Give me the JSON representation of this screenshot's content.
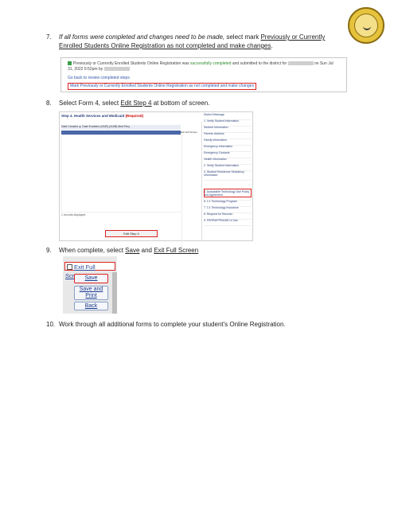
{
  "seal_text": "SCHOOL BOARD OF FLORIDA",
  "steps": {
    "s7": {
      "num": "7.",
      "intro": "If all forms were completed and changes need to be made,",
      "mid": " select mark ",
      "link": "Previously or Currently Enrolled Students Online Registration as not completed and make changes",
      "end": "."
    },
    "s8": {
      "num": "8.",
      "pre": "Select Form 4, select ",
      "link": "Edit Step 4",
      "post": " at bottom of screen."
    },
    "s9": {
      "num": "9.",
      "pre": "When complete, select ",
      "link1": "Save",
      "mid": " and ",
      "link2": "Exit Full Screen"
    },
    "s10": {
      "num": "10.",
      "text": "Work through all additional forms to complete your student's Online Registration."
    }
  },
  "panel7": {
    "line1a": "Previously or Currently Enrolled Students Online Registration was ",
    "line1b": "successfully completed",
    "line1c": " and submitted to the district for ",
    "line1d": " on Sun Jul 31, 2022 6:52pm by ",
    "review_link": "Go back to review completed steps",
    "mark_link": "Mark Previously or Currently Enrolled Students Online Registration as not completed and make changes"
  },
  "panel8": {
    "title": "Step 4. Health Services and Medicaid",
    "required": "(Required)",
    "header": "Date Created  ▲     Date Enabled (4/4/B)     (4/4/B) Med Req",
    "full_screen": "Exit Full Screen",
    "records": "1 records displayed",
    "edit_button": "Edit Step 4",
    "side_items": [
      "District Message",
      "1. Verify Student Information",
      "Student Information",
      "Parents Address",
      "Family Information",
      "Emergency Information",
      "Emergency Contacts",
      "Health Information",
      "2. Verify Student Information",
      "3. Student Residence Residency Information",
      "4. Health Services and Medicaid",
      "5. Acceptable Technology Use Policy and Agreement",
      "6. 1:1 Technology Program",
      "7. 1:1 Technology Insurance",
      "8. Request for Records",
      "9. FERPA/PPRA/DEI # Use"
    ]
  },
  "panel9": {
    "exit_full_screen": "Exit Full Screen",
    "save": "Save",
    "save_print": "Save and Print",
    "back": "Back"
  }
}
